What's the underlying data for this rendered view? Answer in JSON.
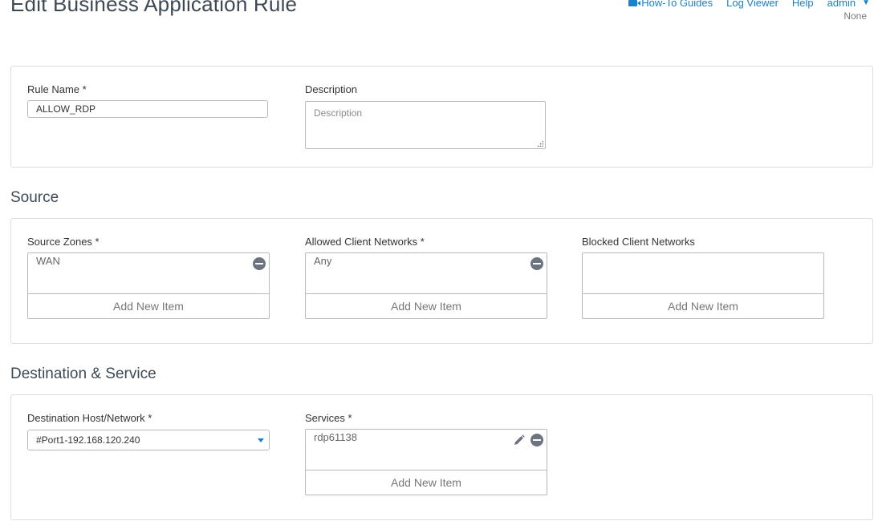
{
  "header": {
    "title": "Edit Business Application Rule",
    "nav": {
      "howto": "How-To Guides",
      "logviewer": "Log Viewer",
      "help": "Help",
      "user": "admin"
    },
    "status": "None"
  },
  "general": {
    "rule_name_label": "Rule Name *",
    "rule_name_value": "ALLOW_RDP",
    "description_label": "Description",
    "description_placeholder": "Description"
  },
  "source": {
    "heading": "Source",
    "zones": {
      "label": "Source Zones *",
      "items": [
        "WAN"
      ],
      "add": "Add New Item"
    },
    "allowed": {
      "label": "Allowed Client Networks *",
      "items": [
        "Any"
      ],
      "add": "Add New Item"
    },
    "blocked": {
      "label": "Blocked Client Networks",
      "items": [],
      "add": "Add New Item"
    }
  },
  "destination": {
    "heading": "Destination & Service",
    "host": {
      "label": "Destination Host/Network *",
      "value": "#Port1-192.168.120.240"
    },
    "services": {
      "label": "Services *",
      "items": [
        "rdp61138"
      ],
      "add": "Add New Item"
    }
  },
  "colors": {
    "accent": "#1a82c8",
    "heading": "#3d4a55",
    "border": "#dcdcdc"
  },
  "icons": [
    "video-icon",
    "caret-down-icon",
    "remove-icon",
    "edit-icon",
    "resize-grip-icon",
    "dropdown-arrow-icon"
  ]
}
